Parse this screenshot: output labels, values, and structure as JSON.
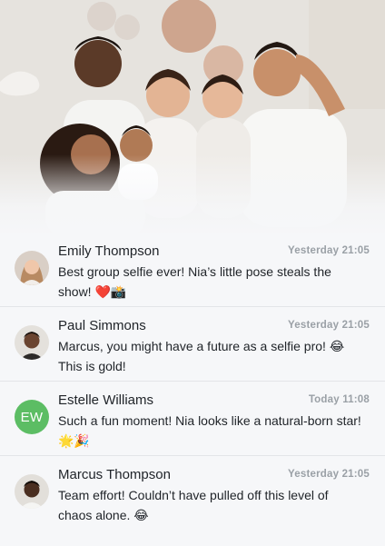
{
  "photo": {
    "description_icon": "group-selfie-photo"
  },
  "comments": [
    {
      "avatar": "photo",
      "avatar_icon": "avatar-emily-icon",
      "name": "Emily Thompson",
      "time": "Yesterday 21:05",
      "message": "Best group selfie ever! Nia’s little pose steals the show! ❤️📸"
    },
    {
      "avatar": "photo",
      "avatar_icon": "avatar-paul-icon",
      "name": "Paul Simmons",
      "time": "Yesterday 21:05",
      "message": "Marcus, you might have a future as a selfie pro! 😂 This is gold!"
    },
    {
      "avatar": "initials",
      "initials": "EW",
      "avatar_color": "#5cbd64",
      "name": "Estelle Williams",
      "time": "Today 11:08",
      "message": "Such a fun moment! Nia looks like a natural-born star! 🌟🎉"
    },
    {
      "avatar": "photo",
      "avatar_icon": "avatar-marcus-icon",
      "name": "Marcus Thompson",
      "time": "Yesterday 21:05",
      "message": "Team effort! Couldn’t have pulled off this level of chaos alone. 😂"
    }
  ]
}
